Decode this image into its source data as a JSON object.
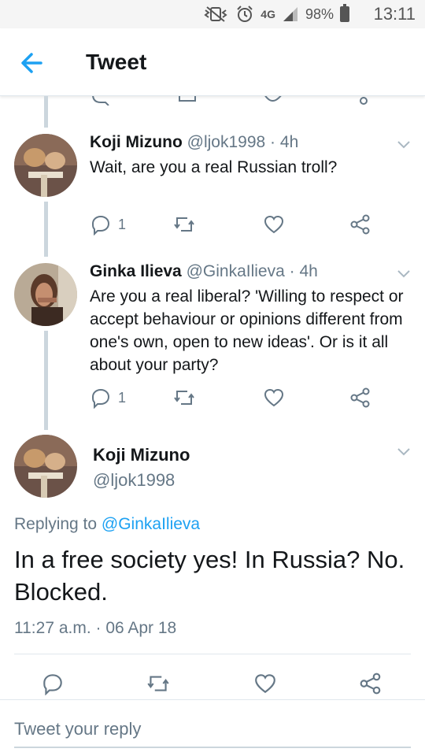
{
  "status_bar": {
    "battery": "98%",
    "network": "4G",
    "time": "13:11"
  },
  "header": {
    "title": "Tweet"
  },
  "thread": [
    {
      "name": "Koji Mizuno",
      "handle": "@ljok1998",
      "age": "4h",
      "text": "Wait, are you a real Russian troll?",
      "reply_count": "1"
    },
    {
      "name": "Ginka Ilieva",
      "handle": "@GinkaIlieva",
      "age": "4h",
      "text": "Are you a real liberal? 'Willing to respect or accept behaviour or opinions different from one's own, open to new ideas'. Or is it all about your party?",
      "reply_count": "1"
    }
  ],
  "main_tweet": {
    "name": "Koji Mizuno",
    "handle": "@ljok1998",
    "replying_label": "Replying to",
    "replying_to": "@GinkaIlieva",
    "text": "In a free society yes! In Russia? No. Blocked.",
    "timestamp": "11:27 a.m. · 06 Apr 18"
  },
  "reply_box": {
    "placeholder": "Tweet your reply"
  },
  "colors": {
    "accent": "#1da1f2",
    "muted": "#657786",
    "text": "#14171a",
    "thread_line": "#ccd6dd"
  }
}
